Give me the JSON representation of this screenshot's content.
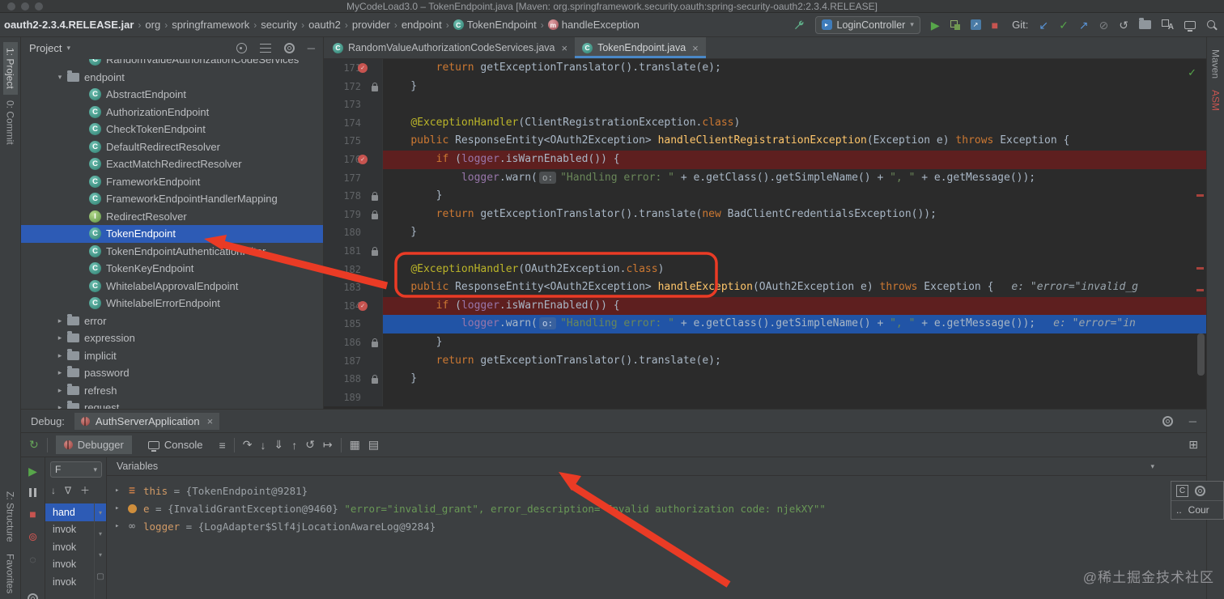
{
  "title_bar": {
    "title": "MyCodeLoad3.0 – TokenEndpoint.java [Maven: org.springframework.security.oauth:spring-security-oauth2:2.3.4.RELEASE]"
  },
  "navbar": {
    "breadcrumbs": [
      {
        "label": "oauth2-2.3.4.RELEASE.jar",
        "bold": true
      },
      {
        "label": "org"
      },
      {
        "label": "springframework"
      },
      {
        "label": "security"
      },
      {
        "label": "oauth2"
      },
      {
        "label": "provider"
      },
      {
        "label": "endpoint"
      },
      {
        "label": "TokenEndpoint",
        "icon": "class"
      },
      {
        "label": "handleException",
        "icon": "method"
      }
    ],
    "run_config": "LoginController",
    "git_label": "Git:"
  },
  "left_stripe": {
    "top": [
      "1: Project",
      "0: Commit"
    ],
    "bottom": [
      "Z: Structure",
      "Favorites"
    ]
  },
  "right_stripe": {
    "labels": [
      {
        "label": "Maven",
        "style": "normal"
      },
      {
        "label": "ASM",
        "style": "red"
      }
    ]
  },
  "project_panel": {
    "title": "Project",
    "tree": [
      {
        "label": "RandomValueAuthorizationCodeServices",
        "kind": "class",
        "clipped": true
      },
      {
        "label": "endpoint",
        "kind": "folder",
        "expanded": true
      },
      {
        "label": "AbstractEndpoint",
        "kind": "class"
      },
      {
        "label": "AuthorizationEndpoint",
        "kind": "class"
      },
      {
        "label": "CheckTokenEndpoint",
        "kind": "class"
      },
      {
        "label": "DefaultRedirectResolver",
        "kind": "class"
      },
      {
        "label": "ExactMatchRedirectResolver",
        "kind": "class"
      },
      {
        "label": "FrameworkEndpoint",
        "kind": "class"
      },
      {
        "label": "FrameworkEndpointHandlerMapping",
        "kind": "class"
      },
      {
        "label": "RedirectResolver",
        "kind": "interface"
      },
      {
        "label": "TokenEndpoint",
        "kind": "class",
        "selected": true
      },
      {
        "label": "TokenEndpointAuthenticationFilter",
        "kind": "class"
      },
      {
        "label": "TokenKeyEndpoint",
        "kind": "class"
      },
      {
        "label": "WhitelabelApprovalEndpoint",
        "kind": "class"
      },
      {
        "label": "WhitelabelErrorEndpoint",
        "kind": "class"
      },
      {
        "label": "error",
        "kind": "folder"
      },
      {
        "label": "expression",
        "kind": "folder"
      },
      {
        "label": "implicit",
        "kind": "folder"
      },
      {
        "label": "password",
        "kind": "folder"
      },
      {
        "label": "refresh",
        "kind": "folder"
      },
      {
        "label": "request",
        "kind": "folder"
      }
    ]
  },
  "editor": {
    "tabs": [
      {
        "label": "RandomValueAuthorizationCodeServices.java",
        "active": false
      },
      {
        "label": "TokenEndpoint.java",
        "active": true
      }
    ],
    "lines": [
      {
        "no": 171,
        "marker": "bp",
        "segs": [
          [
            "        ",
            "p"
          ],
          [
            "return",
            "k"
          ],
          [
            " getExceptionTranslator().translate(e);",
            "p"
          ]
        ]
      },
      {
        "no": 172,
        "marker": "lock",
        "segs": [
          [
            "    }",
            "p"
          ]
        ]
      },
      {
        "no": 173,
        "segs": []
      },
      {
        "no": 174,
        "segs": [
          [
            "    ",
            "p"
          ],
          [
            "@ExceptionHandler",
            "a"
          ],
          [
            "(ClientRegistrationException.",
            "p"
          ],
          [
            "class",
            "k"
          ],
          [
            ")",
            "p"
          ]
        ]
      },
      {
        "no": 175,
        "segs": [
          [
            "    ",
            "p"
          ],
          [
            "public",
            "k"
          ],
          [
            " ResponseEntity<OAuth2Exception> ",
            "p"
          ],
          [
            "handleClientRegistrationException",
            "m"
          ],
          [
            "(Exception e) ",
            "p"
          ],
          [
            "throws",
            "k"
          ],
          [
            " Exception {",
            "p"
          ]
        ]
      },
      {
        "no": 176,
        "bg": "bp",
        "marker": "bp",
        "segs": [
          [
            "        ",
            "p"
          ],
          [
            "if",
            "k"
          ],
          [
            " (",
            "p"
          ],
          [
            "logger",
            "f"
          ],
          [
            ".isWarnEnabled()) {",
            "p"
          ]
        ]
      },
      {
        "no": 177,
        "segs": [
          [
            "            ",
            "p"
          ],
          [
            "logger",
            "f"
          ],
          [
            ".warn(",
            "p"
          ],
          [
            "o:",
            "b"
          ],
          [
            "\"Handling error: \"",
            "s"
          ],
          [
            " + e.getClass().getSimpleName() + ",
            "p"
          ],
          [
            "\", \"",
            "s"
          ],
          [
            " + e.getMessage());",
            "p"
          ]
        ]
      },
      {
        "no": 178,
        "marker": "lock",
        "segs": [
          [
            "        }",
            "p"
          ]
        ]
      },
      {
        "no": 179,
        "marker": "lock",
        "segs": [
          [
            "        ",
            "p"
          ],
          [
            "return",
            "k"
          ],
          [
            " getExceptionTranslator().translate(",
            "p"
          ],
          [
            "new",
            "k"
          ],
          [
            " BadClientCredentialsException());",
            "p"
          ]
        ]
      },
      {
        "no": 180,
        "segs": [
          [
            "    }",
            "p"
          ]
        ]
      },
      {
        "no": 181,
        "marker": "lock",
        "segs": []
      },
      {
        "no": 182,
        "segs": [
          [
            "    ",
            "p"
          ],
          [
            "@ExceptionHandler",
            "a"
          ],
          [
            "(OAuth2Exception.",
            "p"
          ],
          [
            "class",
            "k"
          ],
          [
            ")",
            "p"
          ]
        ]
      },
      {
        "no": 183,
        "segs": [
          [
            "    ",
            "p"
          ],
          [
            "public",
            "k"
          ],
          [
            " ResponseEntity<OAuth2Exception> ",
            "p"
          ],
          [
            "handleException",
            "m"
          ],
          [
            "(OAuth2Exception e) ",
            "p"
          ],
          [
            "throws",
            "k"
          ],
          [
            " Exception {",
            "p"
          ]
        ],
        "hint": "e: \"error=\"invalid_g"
      },
      {
        "no": 184,
        "bg": "bp",
        "marker": "bp",
        "segs": [
          [
            "        ",
            "p"
          ],
          [
            "if",
            "k"
          ],
          [
            " (",
            "p"
          ],
          [
            "logger",
            "f"
          ],
          [
            ".isWarnEnabled()) {",
            "p"
          ]
        ]
      },
      {
        "no": 185,
        "bg": "exec",
        "segs": [
          [
            "            ",
            "p"
          ],
          [
            "logger",
            "f"
          ],
          [
            ".warn(",
            "p"
          ],
          [
            "o:",
            "b"
          ],
          [
            "\"Handling error: \"",
            "s"
          ],
          [
            " + e.getClass().getSimpleName() + ",
            "p"
          ],
          [
            "\", \"",
            "s"
          ],
          [
            " + e.getMessage());",
            "p"
          ]
        ],
        "hint": "e: \"error=\"in"
      },
      {
        "no": 186,
        "marker": "lock",
        "segs": [
          [
            "        }",
            "p"
          ]
        ]
      },
      {
        "no": 187,
        "segs": [
          [
            "        ",
            "p"
          ],
          [
            "return",
            "k"
          ],
          [
            " getExceptionTranslator().translate(e);",
            "p"
          ]
        ]
      },
      {
        "no": 188,
        "marker": "lock",
        "segs": [
          [
            "    }",
            "p"
          ]
        ]
      },
      {
        "no": 189,
        "segs": []
      }
    ]
  },
  "debug_panel": {
    "label": "Debug:",
    "session": {
      "name": "AuthServerApplication"
    },
    "toolbar": {
      "tabs": [
        {
          "label": "Debugger"
        },
        {
          "label": "Console"
        }
      ]
    },
    "frames": {
      "selector": "F",
      "items": [
        {
          "label": "hand",
          "selected": true
        },
        {
          "label": "invok"
        },
        {
          "label": "invok"
        },
        {
          "label": "invok"
        },
        {
          "label": "invok"
        }
      ]
    },
    "variables": {
      "title": "Variables",
      "rows": [
        {
          "icon": "bars",
          "name": "this",
          "value": "{TokenEndpoint@9281}",
          "string": ""
        },
        {
          "icon": "circle",
          "name": "e",
          "value": "{InvalidGrantException@9460} ",
          "string": "\"error=\"invalid_grant\", error_description=\"Invalid authorization code: njekXY\"\""
        },
        {
          "icon": "infinity",
          "name": "logger",
          "value": "{LogAdapter$Slf4jLocationAwareLog@9284}",
          "string": ""
        }
      ]
    },
    "popup": {
      "line2": "Cour"
    }
  },
  "watermark": {
    "text": "@稀土掘金技术社区"
  }
}
